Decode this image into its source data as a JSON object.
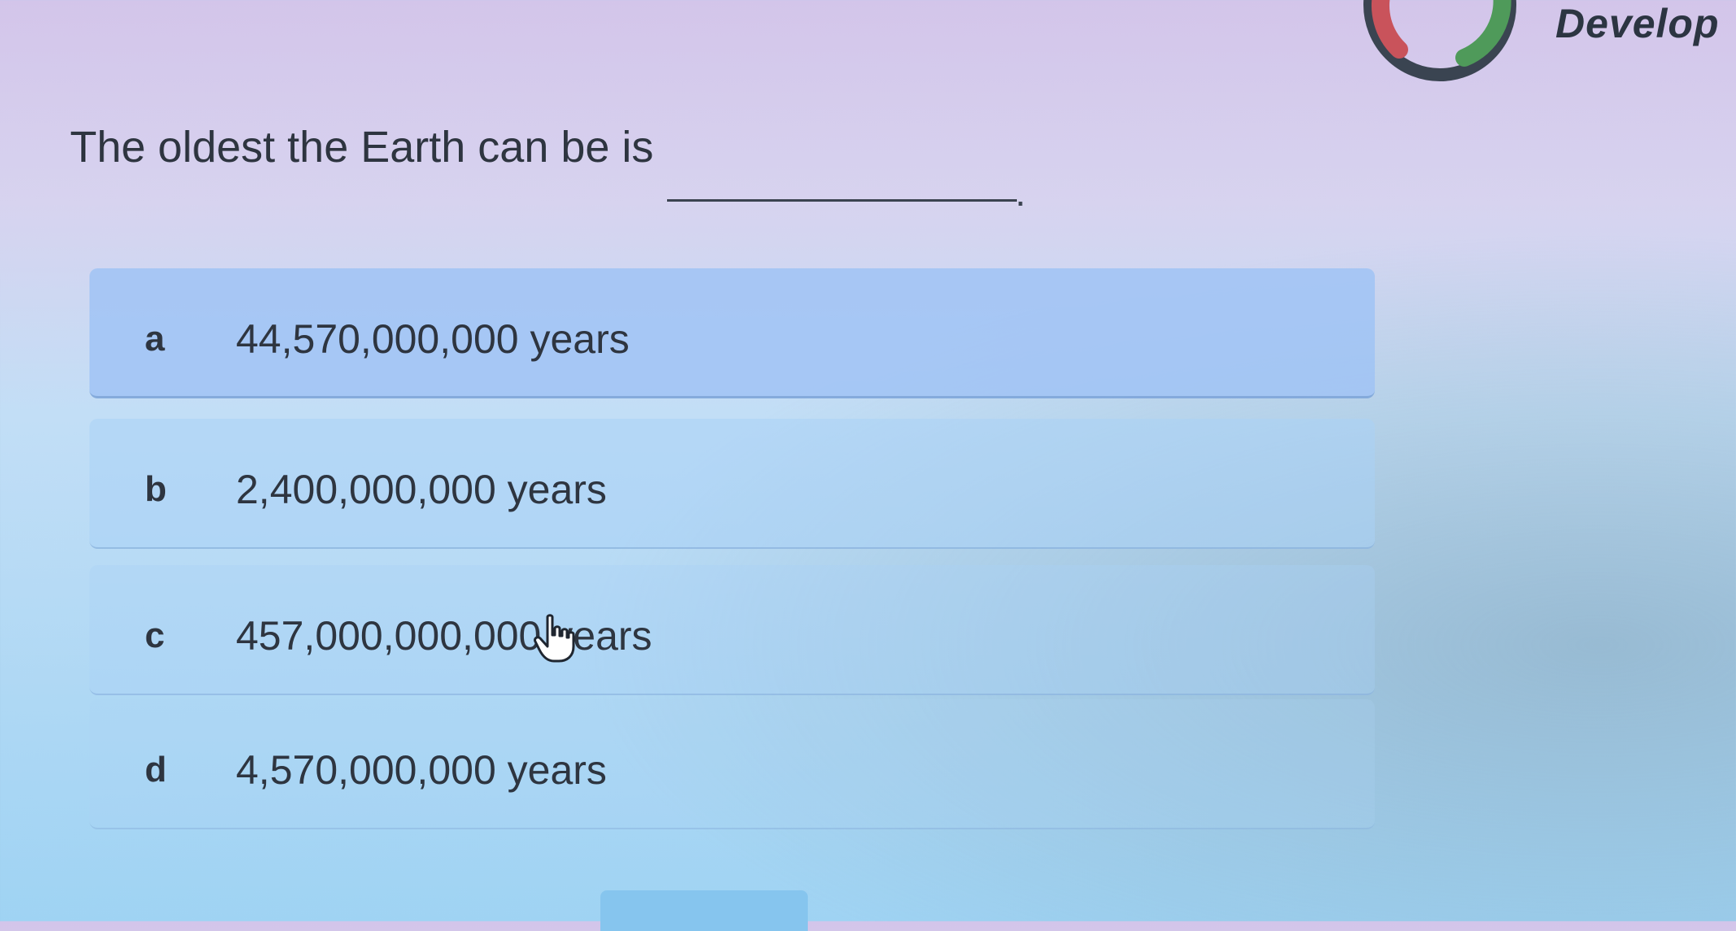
{
  "branding": {
    "label": "Develop",
    "logo_icon": "ring-progress-icon",
    "colors": {
      "ring": "#3a4451",
      "red_arc": "#c9535b",
      "green_arc": "#4f9a5a"
    }
  },
  "question": {
    "text": "The oldest the Earth can be is",
    "blank_suffix": "."
  },
  "options": [
    {
      "letter": "a",
      "text": "44,570,000,000 years"
    },
    {
      "letter": "b",
      "text": "2,400,000,000 years"
    },
    {
      "letter": "c",
      "text": "457,000,000,000 years"
    },
    {
      "letter": "d",
      "text": "4,570,000,000 years"
    }
  ],
  "cursor": {
    "icon": "hand-pointer-icon"
  }
}
